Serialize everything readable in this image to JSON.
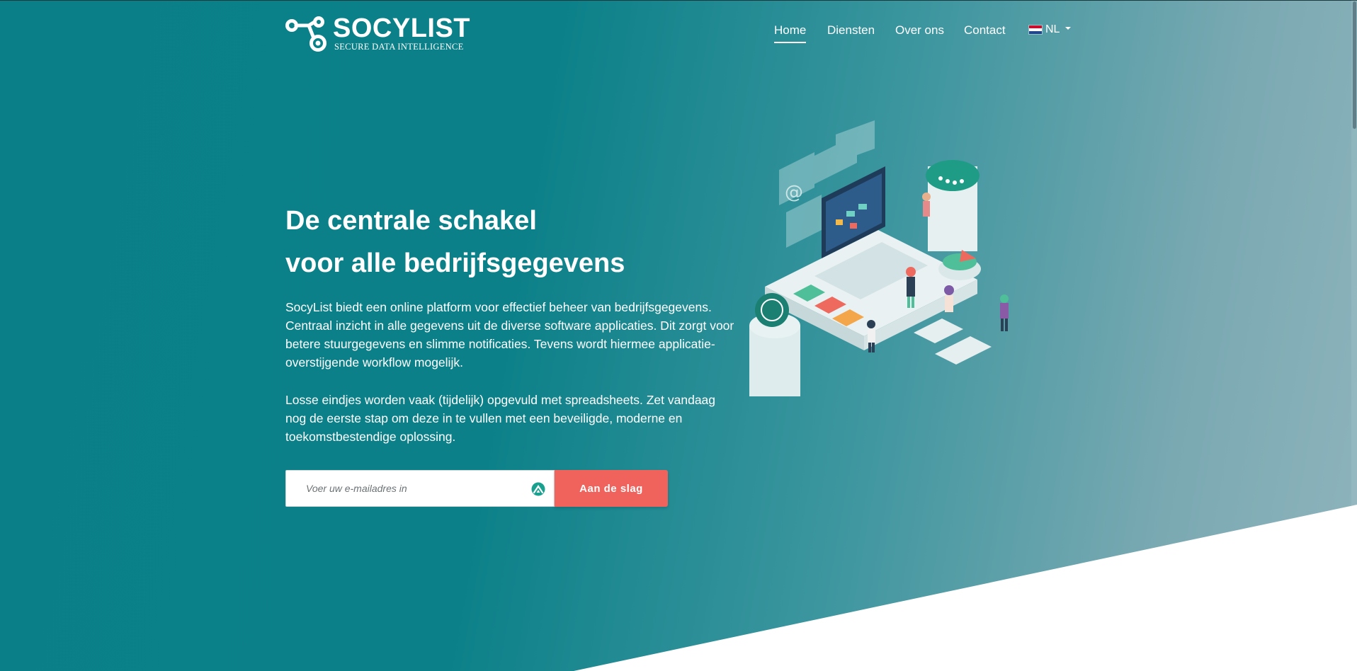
{
  "brand": {
    "name": "SOCYLIST",
    "tagline": "SECURE DATA INTELLIGENCE",
    "logo_icon": "molecule-link-icon"
  },
  "nav": {
    "items": [
      {
        "label": "Home",
        "active": true
      },
      {
        "label": "Diensten",
        "active": false
      },
      {
        "label": "Over ons",
        "active": false
      },
      {
        "label": "Contact",
        "active": false
      }
    ],
    "language": {
      "label": "NL",
      "flag": "netherlands-flag-icon"
    }
  },
  "hero": {
    "headline_line1": "De centrale schakel",
    "headline_line2": "voor alle bedrijfsgegevens",
    "paragraph1": "SocyList biedt een online platform voor effectief beheer van bedrijfsgegevens. Centraal inzicht in alle gegevens uit de diverse software applicaties. Dit zorgt voor betere stuurgegevens en slimme notificaties. Tevens wordt hiermee applicatie-overstijgende workflow mogelijk.",
    "paragraph2": "Losse eindjes worden vaak (tijdelijk) opgevuld met spreadsheets. Zet vandaag nog de eerste stap om deze in te vullen met een beveiligde, moderne en toekomstbestendige oplossing."
  },
  "signup": {
    "placeholder": "Voer uw e-mailadres in",
    "value": "",
    "button_label": "Aan de slag",
    "field_icon": "password-manager-icon"
  },
  "colors": {
    "hero_start": "#0a7f87",
    "hero_end": "#8fb4bd",
    "cta": "#f0625c",
    "text": "#ffffff"
  },
  "illustration": {
    "name": "isometric-data-platform-illustration"
  }
}
